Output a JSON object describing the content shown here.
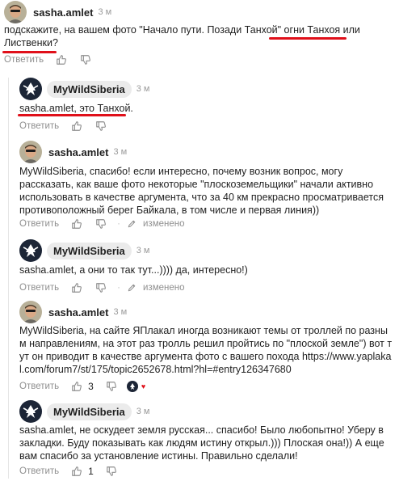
{
  "comments": [
    {
      "author": "sasha.amlet",
      "time": "3 м",
      "text": "подскажите, на вашем фото \"Начало пути. Позади Танхой\" огни Танхоя или Лиственки?",
      "reply_label": "Ответить",
      "likes": "",
      "edited": ""
    },
    {
      "author": "MyWildSiberia",
      "time": "3 м",
      "text": "sasha.amlet, это Танхой.",
      "reply_label": "Ответить",
      "likes": "",
      "edited": ""
    },
    {
      "author": "sasha.amlet",
      "time": "3 м",
      "text": "MyWildSiberia, спасибо! если интересно, почему возник вопрос, могу рассказать, как ваше фото некоторые \"плоскоземельщики\" начали активно использовать в качестве аргумента, что за 40 км прекрасно просматривается противоположный берег Байкала, в том числе и первая линия))",
      "reply_label": "Ответить",
      "likes": "",
      "edited": "изменено"
    },
    {
      "author": "MyWildSiberia",
      "time": "3 м",
      "text": "sasha.amlet, а они то так тут...)))) да, интересно!)",
      "reply_label": "Ответить",
      "likes": "",
      "edited": "изменено"
    },
    {
      "author": "sasha.amlet",
      "time": "3 м",
      "text": "MyWildSiberia, на сайте ЯПлакал иногда возникают темы от троллей по разным направлениям, на этот раз тролль решил пройтись по \"плоской земле\") вот тут он приводит в качестве аргумента фото с вашего похода https://www.yaplakal.com/forum7/st/175/topic2652678.html?hl=#entry126347680",
      "reply_label": "Ответить",
      "likes": "3",
      "edited": ""
    },
    {
      "author": "MyWildSiberia",
      "time": "3 м",
      "text": "sasha.amlet, не оскудеет земля русская... спасибо! Было любопытно! Уберу в закладки. Буду показывать как людям истину открыл.))) Плоская она!)) А еще вам спасибо за установление истины. Правильно сделали!",
      "reply_label": "Ответить",
      "likes": "1",
      "edited": ""
    }
  ],
  "colors": {
    "accent_underline": "#e0101a",
    "muted": "#8f8f8f"
  },
  "icons": [
    "thumb-up-icon",
    "thumb-down-icon",
    "pencil-icon",
    "user-badge-icon"
  ]
}
